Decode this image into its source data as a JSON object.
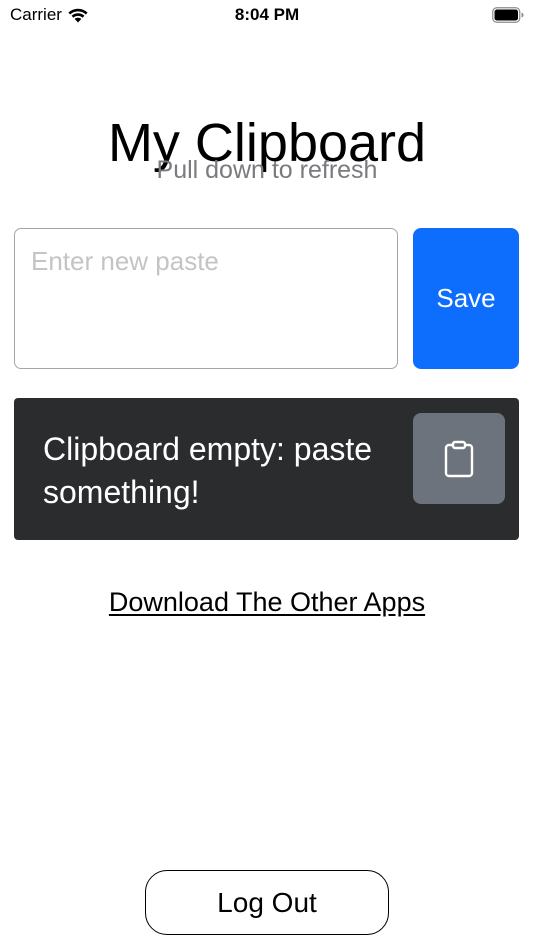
{
  "status_bar": {
    "carrier": "Carrier",
    "time": "8:04 PM",
    "wifi_icon": "wifi-icon",
    "battery_icon": "battery-full-icon"
  },
  "header": {
    "title": "My Clipboard",
    "subtitle": "Pull down to refresh"
  },
  "paste_form": {
    "value": "",
    "placeholder": "Enter new paste",
    "save_label": "Save"
  },
  "clipboard": {
    "message": "Clipboard empty: paste something!",
    "copy_icon": "clipboard-icon"
  },
  "links": {
    "download_other_apps": "Download The Other Apps"
  },
  "footer": {
    "logout_label": "Log Out"
  },
  "colors": {
    "accent": "#0d6efd",
    "card_background": "#2b2c2e",
    "copy_button": "#6c737c",
    "subtitle": "#7b7b7f"
  }
}
